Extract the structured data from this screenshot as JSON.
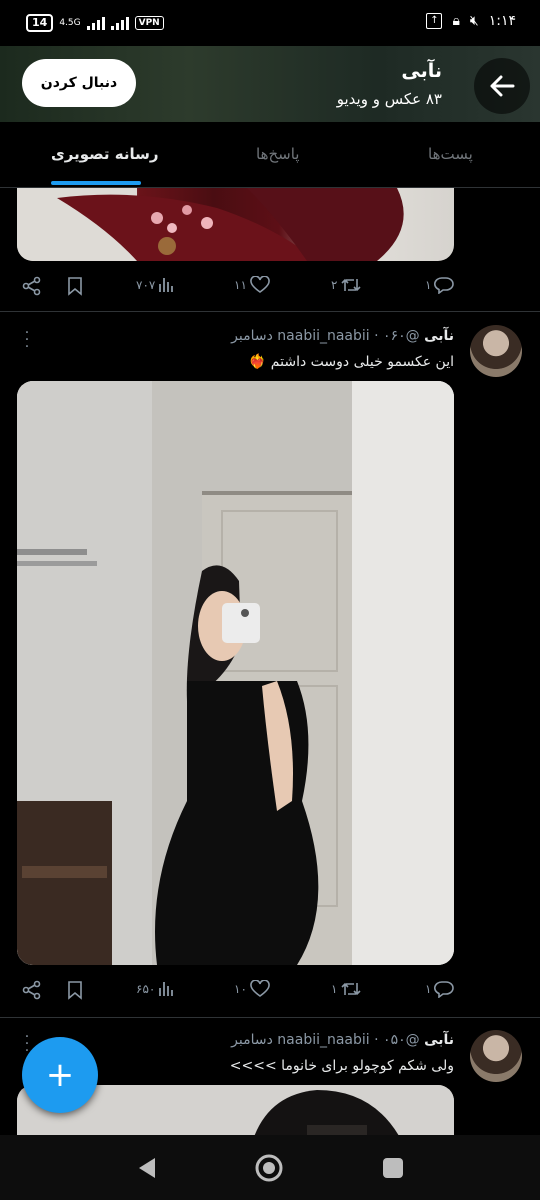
{
  "status_bar": {
    "battery": "14",
    "network": "4.5G",
    "vpn": "VPN",
    "time": "۱:۱۴"
  },
  "header": {
    "name": "نآبی",
    "count": "۸۳ عکس و ویدیو",
    "follow_label": "دنبال کردن"
  },
  "tabs": [
    {
      "label": "رسانه تصویری",
      "active": true
    },
    {
      "label": "پاسخ‌ها",
      "active": false
    },
    {
      "label": "پست‌ها",
      "active": false
    }
  ],
  "posts": [
    {
      "views": "۷۰۷",
      "likes": "۱۱",
      "reposts": "۲",
      "replies": "۱"
    },
    {
      "name": "نآبی",
      "handle": "@naabii_naabii",
      "date": "۰۶۰ دسامبر",
      "text": "این عکسمو خیلی دوست داشتم ❤️‍🔥",
      "views": "۶۵۰",
      "likes": "۱۰",
      "reposts": "۱",
      "replies": "۱"
    },
    {
      "name": "نآبی",
      "handle": "@naabii_naabii",
      "date": "۰۵۰ دسامبر",
      "text": "ولی شکم کوچولو برای خانوما >>>>"
    }
  ],
  "colors": {
    "accent": "#1d9bf0",
    "background": "#000000",
    "text_secondary": "#8b98a5"
  }
}
